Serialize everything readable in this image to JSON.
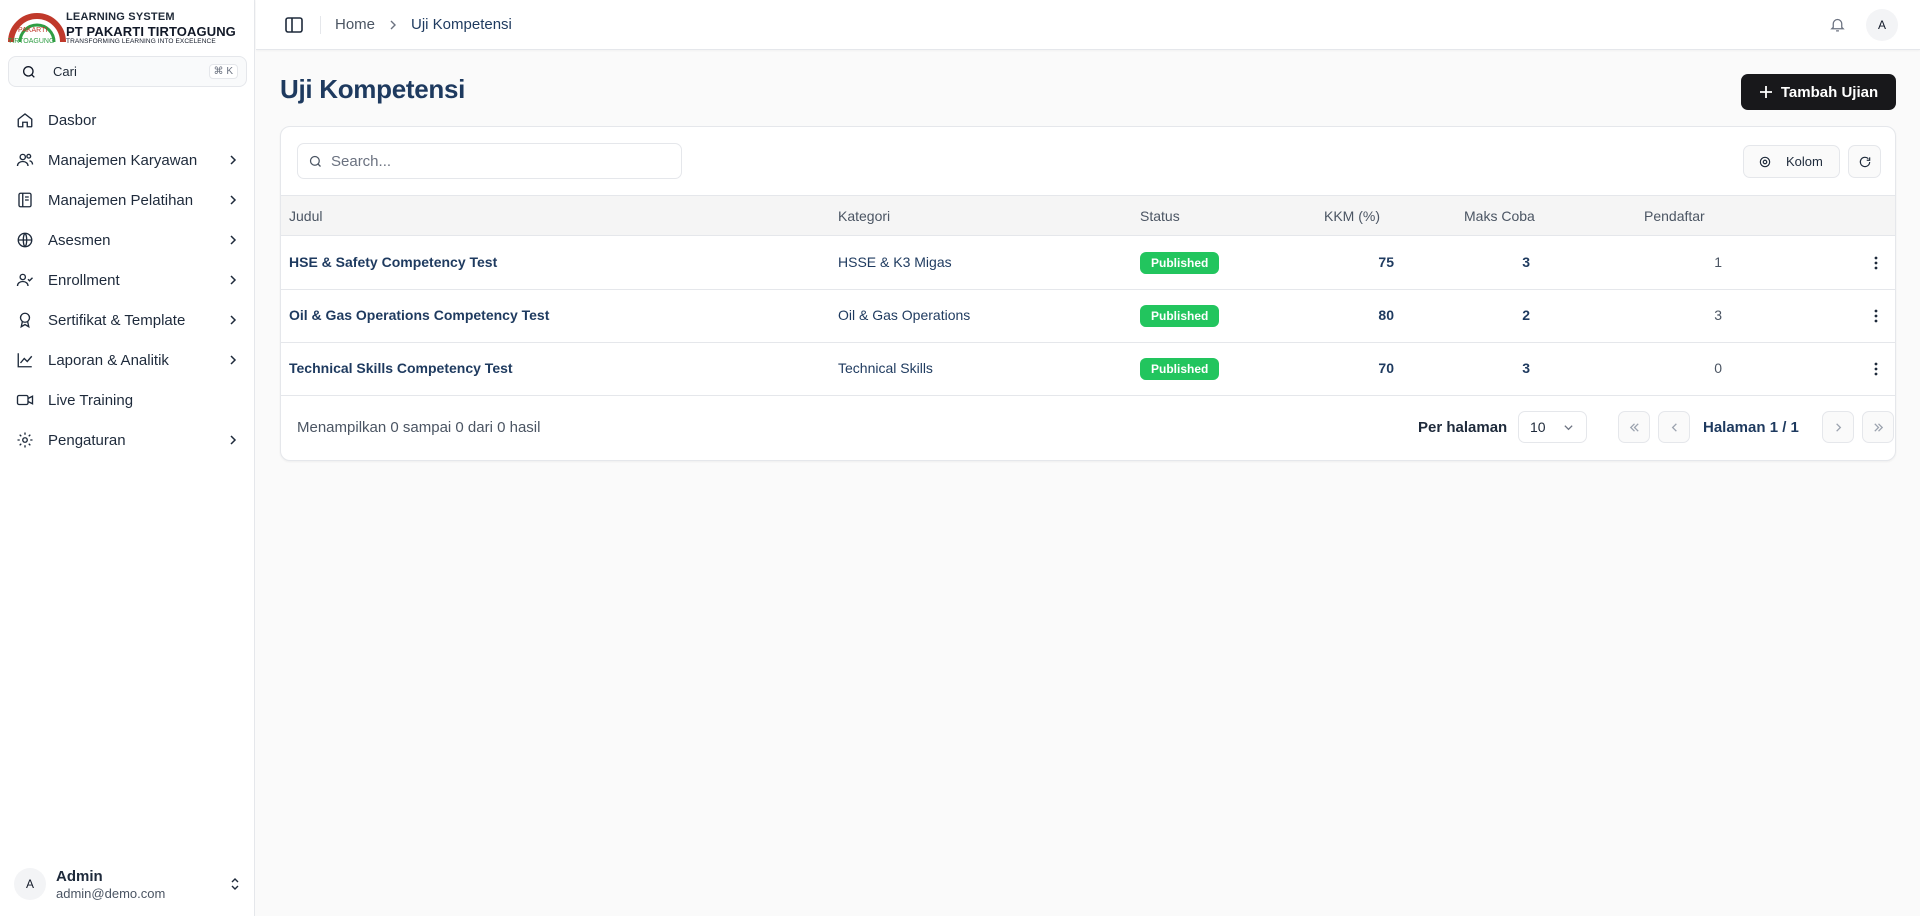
{
  "brand": {
    "line1": "LEARNING SYSTEM",
    "line2": "PT PAKARTI TIRTOAGUNG",
    "tagline": "TRANSFORMING LEARNING INTO EXCELENCE",
    "logo_left_red": "PAKARTI",
    "logo_left_green": "TIRTOAGUNG"
  },
  "sidebar": {
    "search_placeholder": "Cari",
    "search_shortcut": "⌘ K",
    "items": [
      {
        "label": "Dasbor",
        "icon": "home-icon",
        "has_children": false
      },
      {
        "label": "Manajemen Karyawan",
        "icon": "users-icon",
        "has_children": true
      },
      {
        "label": "Manajemen Pelatihan",
        "icon": "book-icon",
        "has_children": true
      },
      {
        "label": "Asesmen",
        "icon": "globe-icon",
        "has_children": true
      },
      {
        "label": "Enrollment",
        "icon": "user-check-icon",
        "has_children": true
      },
      {
        "label": "Sertifikat & Template",
        "icon": "award-icon",
        "has_children": true
      },
      {
        "label": "Laporan & Analitik",
        "icon": "chart-line-icon",
        "has_children": true
      },
      {
        "label": "Live Training",
        "icon": "video-icon",
        "has_children": false
      },
      {
        "label": "Pengaturan",
        "icon": "gear-icon",
        "has_children": true
      }
    ],
    "user": {
      "initial": "A",
      "name": "Admin",
      "email": "admin@demo.com"
    }
  },
  "header": {
    "breadcrumb_home": "Home",
    "breadcrumb_current": "Uji Kompetensi",
    "avatar_initial": "A"
  },
  "page": {
    "title": "Uji Kompetensi",
    "add_button": "Tambah Ujian"
  },
  "table": {
    "search_placeholder": "Search...",
    "columns_button": "Kolom",
    "headers": {
      "judul": "Judul",
      "kategori": "Kategori",
      "status": "Status",
      "kkm": "KKM (%)",
      "maks": "Maks Coba",
      "pendaftar": "Pendaftar"
    },
    "rows": [
      {
        "judul": "HSE & Safety Competency Test",
        "kategori": "HSSE & K3 Migas",
        "status": "Published",
        "kkm": "75",
        "maks": "3",
        "pendaftar": "1"
      },
      {
        "judul": "Oil & Gas Operations Competency Test",
        "kategori": "Oil & Gas Operations",
        "status": "Published",
        "kkm": "80",
        "maks": "2",
        "pendaftar": "3"
      },
      {
        "judul": "Technical Skills Competency Test",
        "kategori": "Technical Skills",
        "status": "Published",
        "kkm": "70",
        "maks": "3",
        "pendaftar": "0"
      }
    ],
    "footer_info": "Menampilkan 0 sampai 0 dari 0 hasil",
    "per_page_label": "Per halaman",
    "per_page_value": "10",
    "page_label": "Halaman 1 / 1"
  },
  "colors": {
    "primary_text": "#1e3a5f",
    "badge_green": "#22c55e",
    "button_dark": "#18181b"
  }
}
